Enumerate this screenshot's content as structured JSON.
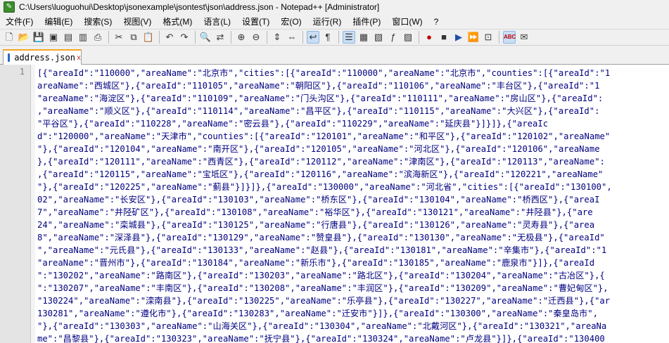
{
  "window": {
    "title": "C:\\Users\\luoguohui\\Desktop\\jsonexample\\jsontest\\json\\address.json - Notepad++ [Administrator]"
  },
  "menu": [
    "文件(F)",
    "编辑(E)",
    "搜索(S)",
    "视图(V)",
    "格式(M)",
    "语言(L)",
    "设置(T)",
    "宏(O)",
    "运行(R)",
    "插件(P)",
    "窗口(W)",
    "?"
  ],
  "toolbar": {
    "icons": [
      "new-file-icon",
      "open-file-icon",
      "save-icon",
      "save-all-icon",
      "close-icon",
      "close-all-icon",
      "print-icon",
      "cut-icon",
      "copy-icon",
      "paste-icon",
      "undo-icon",
      "redo-icon",
      "find-icon",
      "replace-icon",
      "zoom-in-icon",
      "zoom-out-icon",
      "sync-vertical-icon",
      "sync-horizontal-icon",
      "word-wrap-icon",
      "show-all-chars-icon",
      "indent-guide-icon",
      "user-define-icon",
      "doc-map-icon",
      "function-list-icon",
      "folder-workspace-icon",
      "record-macro-icon",
      "stop-macro-icon",
      "play-macro-icon",
      "run-macro-multiple-icon",
      "save-macro-icon",
      "spell-check-icon",
      "spell-options-icon"
    ]
  },
  "tab": {
    "label": "address.json",
    "close": "x"
  },
  "editor": {
    "line_number": "1",
    "lines": [
      "[{\"areaId\":\"110000\",\"areaName\":\"北京市\",\"cities\":[{\"areaId\":\"110000\",\"areaName\":\"北京市\",\"counties\":[{\"areaId\":\"1",
      "areaName\":\"西城区\"},{\"areaId\":\"110105\",\"areaName\":\"朝阳区\"},{\"areaId\":\"110106\",\"areaName\":\"丰台区\"},{\"areaId\":\"1",
      "\"areaName\":\"海淀区\"},{\"areaId\":\"110109\",\"areaName\":\"门头沟区\"},{\"areaId\":\"110111\",\"areaName\":\"房山区\"},{\"areaId\":",
      ",\"areaName\":\"顺义区\"},{\"areaId\":\"110114\",\"areaName\":\"昌平区\"},{\"areaId\":\"110115\",\"areaName\":\"大兴区\"},{\"areaId\":",
      "\"平谷区\"},{\"areaId\":\"110228\",\"areaName\":\"密云县\"},{\"areaId\":\"110229\",\"areaName\":\"延庆县\"}]}]},{\"areaIc",
      "d\":\"120000\",\"areaName\":\"天津市\",\"counties\":[{\"areaId\":\"120101\",\"areaName\":\"和平区\"},{\"areaId\":\"120102\",\"areaName\"",
      "\"},{\"areaId\":\"120104\",\"areaName\":\"南开区\"},{\"areaId\":\"120105\",\"areaName\":\"河北区\"},{\"areaId\":\"120106\",\"areaName",
      "},{\"areaId\":\"120111\",\"areaName\":\"西青区\"},{\"areaId\":\"120112\",\"areaName\":\"津南区\"},{\"areaId\":\"120113\",\"areaName\":",
      ",{\"areaId\":\"120115\",\"areaName\":\"宝坻区\"},{\"areaId\":\"120116\",\"areaName\":\"滨海新区\"},{\"areaId\":\"120221\",\"areaName\"",
      "\"},{\"areaId\":\"120225\",\"areaName\":\"蓟县\"}]}]},{\"areaId\":\"130000\",\"areaName\":\"河北省\",\"cities\":[{\"areaId\":\"130100\",",
      "02\",\"areaName\":\"长安区\"},{\"areaId\":\"130103\",\"areaName\":\"桥东区\"},{\"areaId\":\"130104\",\"areaName\":\"桥西区\"},{\"areaI",
      "7\",\"areaName\":\"井陉矿区\"},{\"areaId\":\"130108\",\"areaName\":\"裕华区\"},{\"areaId\":\"130121\",\"areaName\":\"井陉县\"},{\"are",
      "24\",\"areaName\":\"栾城县\"},{\"areaId\":\"130125\",\"areaName\":\"行唐县\"},{\"areaId\":\"130126\",\"areaName\":\"灵寿县\"},{\"area",
      "8\",\"areaName\":\"深泽县\"},{\"areaId\":\"130129\",\"areaName\":\"赞皇县\"},{\"areaId\":\"130130\",\"areaName\":\"无极县\"},{\"areaId\"",
      "\",\"areaName\":\"元氏县\"},{\"areaId\":\"130133\",\"areaName\":\"赵县\"},{\"areaId\":\"130181\",\"areaName\":\"辛集市\"},{\"areaId\":\"1",
      "\"areaName\":\"晋州市\"},{\"areaId\":\"130184\",\"areaName\":\"新乐市\"},{\"areaId\":\"130185\",\"areaName\":\"鹿泉市\"}]},{\"areaId",
      "\":\"130202\",\"areaName\":\"路南区\"},{\"areaId\":\"130203\",\"areaName\":\"路北区\"},{\"areaId\":\"130204\",\"areaName\":\"古冶区\"},{",
      "\":\"130207\",\"areaName\":\"丰南区\"},{\"areaId\":\"130208\",\"areaName\":\"丰润区\"},{\"areaId\":\"130209\",\"areaName\":\"曹妃甸区\"},",
      "\"130224\",\"areaName\":\"滦南县\"},{\"areaId\":\"130225\",\"areaName\":\"乐亭县\"},{\"areaId\":\"130227\",\"areaName\":\"迁西县\"},{\"ar",
      "130281\",\"areaName\":\"遵化市\"},{\"areaId\":\"130283\",\"areaName\":\"迁安市\"}]},{\"areaId\":\"130300\",\"areaName\":\"秦皇岛市\",",
      "\"},{\"areaId\":\"130303\",\"areaName\":\"山海关区\"},{\"areaId\":\"130304\",\"areaName\":\"北戴河区\"},{\"areaId\":\"130321\",\"areaNa",
      "me\":\"昌黎县\"},{\"areaId\":\"130323\",\"areaName\":\"抚宁县\"},{\"areaId\":\"130324\",\"areaName\":\"卢龙县\"}]},{\"areaId\":\"130400"
    ]
  }
}
